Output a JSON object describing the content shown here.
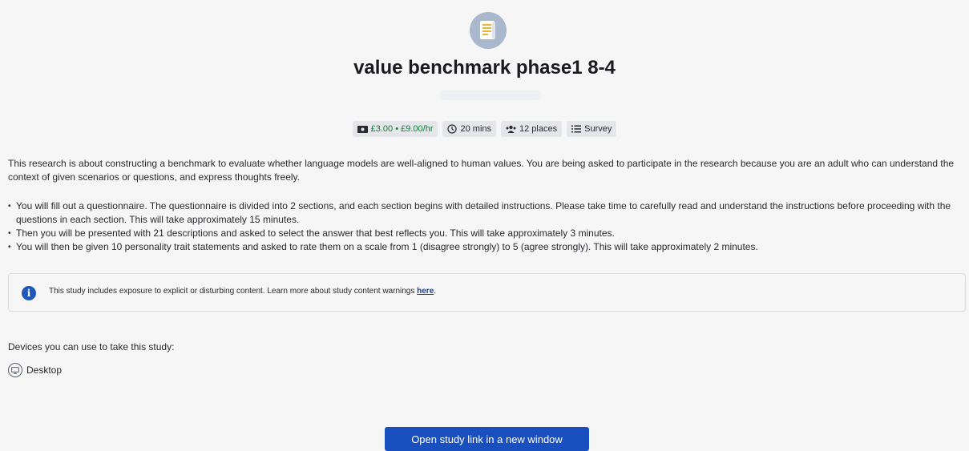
{
  "study": {
    "title": "value benchmark phase1 8-4",
    "badges": {
      "reward": "£3.00 • £9.00/hr",
      "duration": "20 mins",
      "places": "12 places",
      "type": "Survey"
    },
    "description": "This research is about constructing a benchmark to evaluate whether language models are well-aligned to human values. You are being asked to participate in the research because you are an adult who can understand the context of given scenarios or questions, and express thoughts freely.",
    "bullets": [
      "You will fill out a questionnaire. The questionnaire is divided into 2 sections, and each section begins with detailed instructions. Please take time to carefully read and understand the instructions before proceeding with the questions in each section. This will take approximately 15 minutes.",
      "Then you will be presented with 21 descriptions and asked to select the answer that best reflects you. This will take approximately 3 minutes.",
      "You will then be given 10 personality trait statements and asked to rate them on a scale from 1 (disagree strongly) to 5 (agree strongly). This will take approximately 2 minutes."
    ]
  },
  "warning": {
    "text": "This study includes exposure to explicit or disturbing content. Learn more about study content warnings ",
    "link_label": "here",
    "suffix": ".",
    "icon": "info-icon"
  },
  "devices": {
    "label": "Devices you can use to take this study:",
    "items": [
      {
        "label": "Desktop",
        "icon": "desktop-icon"
      }
    ]
  },
  "actions": {
    "open_study_label": "Open study link in a new window"
  },
  "colors": {
    "accent": "#1a4fbf",
    "reward": "#167d3a",
    "info": "#1f56b8"
  }
}
